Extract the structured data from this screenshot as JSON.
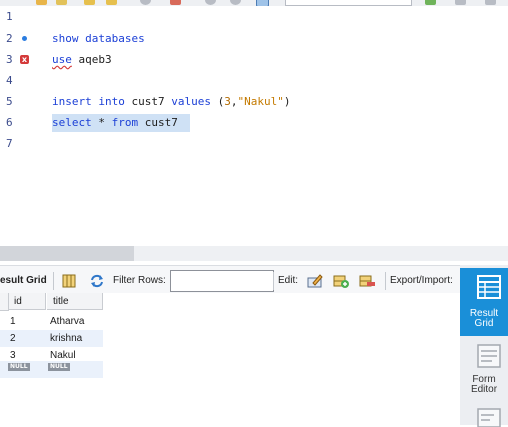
{
  "editor": {
    "lines": [
      {
        "num": "1",
        "text": ""
      },
      {
        "num": "2",
        "kw1": "show",
        "kw2": "databases"
      },
      {
        "num": "3",
        "kw1": "use",
        "rest": "aqeb3"
      },
      {
        "num": "4",
        "text": ""
      },
      {
        "num": "5",
        "kw1": "insert",
        "kw2": "into",
        "ident": "cust7",
        "kw3": "values",
        "open": "(",
        "numval": "3",
        "comma": ",",
        "strval": "\"Nakul\"",
        "close": ")"
      },
      {
        "num": "6",
        "kw1": "select",
        "star": "*",
        "kw2": "from",
        "ident": "cust7"
      },
      {
        "num": "7",
        "text": ""
      }
    ],
    "error_marker": "x"
  },
  "result_toolbar": {
    "result_grid_label": "esult Grid",
    "filter_rows_label": "Filter Rows:",
    "filter_value": "",
    "edit_label": "Edit:",
    "export_label": "Export/Import:"
  },
  "grid": {
    "columns": [
      "id",
      "title"
    ],
    "rows": [
      {
        "id": "1",
        "title": "Atharva"
      },
      {
        "id": "2",
        "title": "krishna"
      },
      {
        "id": "3",
        "title": "Nakul"
      }
    ],
    "null_label": "NULL"
  },
  "side_panel": {
    "result_grid_line1": "Result",
    "result_grid_line2": "Grid",
    "form_editor_line1": "Form",
    "form_editor_line2": "Editor"
  },
  "colors": {
    "keyword": "#1b3fd6",
    "string": "#c47a00",
    "selection": "#cfe1f5",
    "side_active": "#1a8fd8"
  }
}
